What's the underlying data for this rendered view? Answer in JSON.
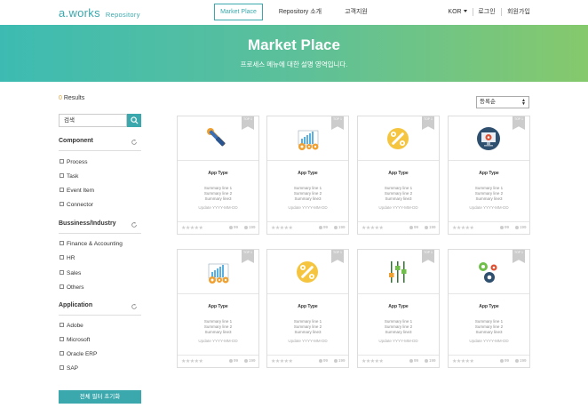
{
  "header": {
    "logo": "a.works",
    "logo_sub": "Repository",
    "nav": {
      "marketplace": "Market Place",
      "repository": "Repository 소개",
      "support": "고객지원"
    },
    "language": "KOR",
    "login": "로그인",
    "signup": "회원가입"
  },
  "banner": {
    "title": "Market Place",
    "subtitle": "프로세스 메뉴에 대한 설명 영역입니다."
  },
  "sidebar": {
    "results_count": "0",
    "results_label": " Results",
    "search_placeholder": "검색",
    "groups": [
      {
        "title": "Component",
        "items": [
          "Process",
          "Task",
          "Event Item",
          "Connector"
        ]
      },
      {
        "title": "Bussiness/Industry",
        "items": [
          "Finance & Accounting",
          "HR",
          "Sales",
          "Others"
        ]
      },
      {
        "title": "Application",
        "items": [
          "Adobe",
          "Microsoft",
          "Oracle ERP",
          "SAP"
        ]
      }
    ],
    "reset_label": "전체 필터 초기화"
  },
  "sort": {
    "selected": "등록순"
  },
  "cards": [
    {
      "icon": "tools-icon",
      "ribbon": "TOP 1",
      "type": "App Type",
      "summary": [
        "Summary line 1",
        "Summary line 2",
        "Summary line3"
      ],
      "update": "Update YYYY-MM-DD",
      "views": "99",
      "downloads": "199"
    },
    {
      "icon": "chart-gears-icon",
      "ribbon": "TOP 1",
      "type": "App Type",
      "summary": [
        "Summary line 1",
        "Summary line 2",
        "Summary line3"
      ],
      "update": "Update YYYY-MM-DD",
      "views": "99",
      "downloads": "199"
    },
    {
      "icon": "wrench-circle-icon",
      "ribbon": "TOP 1",
      "type": "App Type",
      "summary": [
        "Summary line 1",
        "Summary line 2",
        "Summary line3"
      ],
      "update": "Update YYYY-MM-DD",
      "views": "99",
      "downloads": "199"
    },
    {
      "icon": "monitor-gear-icon",
      "ribbon": "TOP 1",
      "type": "App Type",
      "summary": [
        "Summary line 1",
        "Summary line 2",
        "Summary line3"
      ],
      "update": "Update YYYY-MM-DD",
      "views": "99",
      "downloads": "199"
    },
    {
      "icon": "chart-gears-icon",
      "ribbon": "TOP 1",
      "type": "App Type",
      "summary": [
        "Summary line 1",
        "Summary line 2",
        "Summary line3"
      ],
      "update": "Update YYYY-MM-DD",
      "views": "99",
      "downloads": "199"
    },
    {
      "icon": "wrench-circle-icon",
      "ribbon": "TOP 1",
      "type": "App Type",
      "summary": [
        "Summary line 1",
        "Summary line 2",
        "Summary line3"
      ],
      "update": "Update YYYY-MM-DD",
      "views": "99",
      "downloads": "199"
    },
    {
      "icon": "sliders-icon",
      "ribbon": "TOP 1",
      "type": "App Type",
      "summary": [
        "Summary line 1",
        "Summary line 2",
        "Summary line3"
      ],
      "update": "Update YYYY-MM-DD",
      "views": "99",
      "downloads": "199"
    },
    {
      "icon": "gears-icon",
      "ribbon": "TOP 1",
      "type": "App Type",
      "summary": [
        "Summary line 1",
        "Summary line 2",
        "Summary line3"
      ],
      "update": "Update YYYY-MM-DD",
      "views": "99",
      "downloads": "199"
    }
  ],
  "colors": {
    "accent": "#3aa8ad",
    "banner_start": "#3dbbb2",
    "banner_end": "#86c96c",
    "results_count": "#e2a13a"
  }
}
